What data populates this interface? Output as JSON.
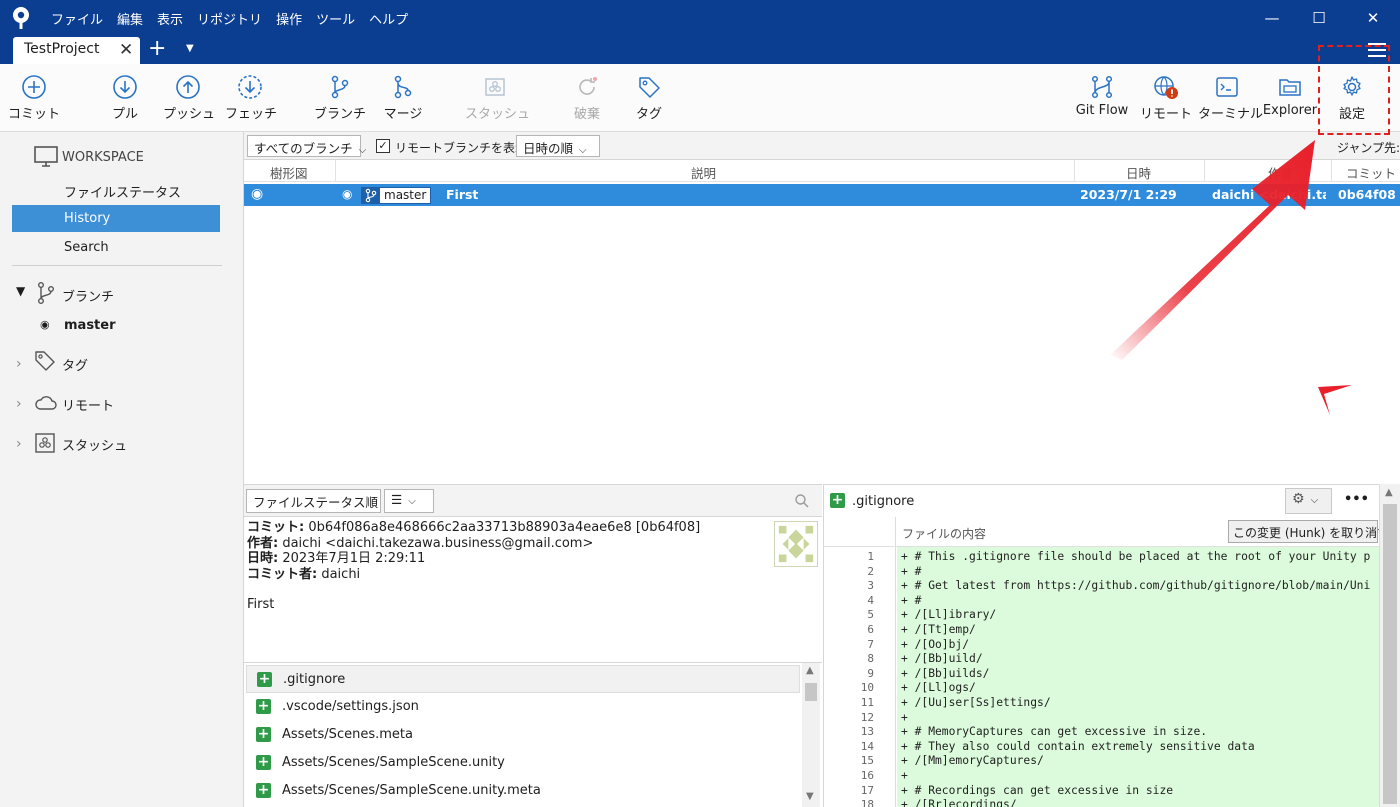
{
  "menu": [
    "ファイル",
    "編集",
    "表示",
    "リポジトリ",
    "操作",
    "ツール",
    "ヘルプ"
  ],
  "window_controls": {
    "minimize": "—",
    "maximize": "☐",
    "close": "✕"
  },
  "tab": {
    "name": "TestProject",
    "close": "✕",
    "add": "+",
    "menu": "▼"
  },
  "toolbar": {
    "commit": "コミット",
    "pull": "プル",
    "push": "プッシュ",
    "fetch": "フェッチ",
    "branch": "ブランチ",
    "merge": "マージ",
    "stash": "スタッシュ",
    "discard": "破棄",
    "tag": "タグ",
    "gitflow": "Git Flow",
    "remote": "リモート",
    "terminal": "ターミナル",
    "explorer": "Explorer",
    "settings": "設定"
  },
  "sidebar": {
    "workspace": "WORKSPACE",
    "file_status": "ファイルステータス",
    "history": "History",
    "search": "Search",
    "branches": "ブランチ",
    "current_branch": "master",
    "tags": "タグ",
    "remotes": "リモート",
    "stashes": "スタッシュ"
  },
  "filters": {
    "branch_filter": "すべてのブランチ",
    "show_remote": "リモートブランチを表示",
    "sort": "日時の順",
    "jump_to": "ジャンプ先:"
  },
  "history_columns": {
    "graph": "樹形図",
    "description": "説明",
    "date": "日時",
    "author": "作者",
    "commit": "コミット"
  },
  "commits": [
    {
      "branch": "master",
      "message": "First",
      "date": "2023/7/1  2:29",
      "author": "daichi <daichi.tak",
      "hash": "0b64f08"
    }
  ],
  "file_pane": {
    "sort": "ファイルステータス順",
    "view": "☰"
  },
  "commit_detail": {
    "commit_label": "コミット:",
    "commit_value": "0b64f086a8e468666c2aa33713b88903a4eae6e8 [0b64f08]",
    "author_label": "作者:",
    "author_value": "daichi <daichi.takezawa.business@gmail.com>",
    "date_label": "日時:",
    "date_value": "2023年7月1日 2:29:11",
    "committer_label": "コミット者:",
    "committer_value": "daichi",
    "message": "First"
  },
  "files": [
    ".gitignore",
    ".vscode/settings.json",
    "Assets/Scenes.meta",
    "Assets/Scenes/SampleScene.unity",
    "Assets/Scenes/SampleScene.unity.meta"
  ],
  "diff": {
    "file": ".gitignore",
    "content_label": "ファイルの内容",
    "revert_hunk": "この変更 (Hunk) を取り消す",
    "more": "•••",
    "lines": [
      {
        "n": "1",
        "t": "+ # This .gitignore file should be placed at the root of your Unity p"
      },
      {
        "n": "2",
        "t": "+ #"
      },
      {
        "n": "3",
        "t": "+ # Get latest from https://github.com/github/gitignore/blob/main/Uni"
      },
      {
        "n": "4",
        "t": "+ #"
      },
      {
        "n": "5",
        "t": "+ /[Ll]ibrary/"
      },
      {
        "n": "6",
        "t": "+ /[Tt]emp/"
      },
      {
        "n": "7",
        "t": "+ /[Oo]bj/"
      },
      {
        "n": "8",
        "t": "+ /[Bb]uild/"
      },
      {
        "n": "9",
        "t": "+ /[Bb]uilds/"
      },
      {
        "n": "10",
        "t": "+ /[Ll]ogs/"
      },
      {
        "n": "11",
        "t": "+ /[Uu]ser[Ss]ettings/"
      },
      {
        "n": "12",
        "t": "+"
      },
      {
        "n": "13",
        "t": "+ # MemoryCaptures can get excessive in size."
      },
      {
        "n": "14",
        "t": "+ # They also could contain extremely sensitive data"
      },
      {
        "n": "15",
        "t": "+ /[Mm]emoryCaptures/"
      },
      {
        "n": "16",
        "t": "+"
      },
      {
        "n": "17",
        "t": "+ # Recordings can get excessive in size"
      },
      {
        "n": "18",
        "t": "+ /[Rr]ecordings/"
      }
    ]
  },
  "colors": {
    "titlebar": "#0b3d91",
    "selection": "#2f8cdd",
    "sidebar_selection": "#3d8fd6",
    "added_line": "#dcfbdc",
    "annotation": "#e0201e"
  }
}
